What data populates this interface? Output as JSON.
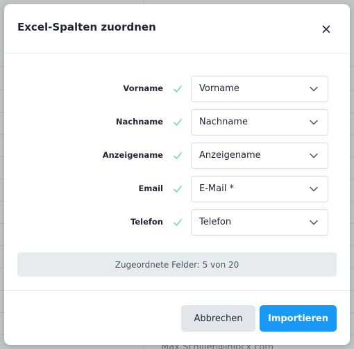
{
  "modal": {
    "title": "Excel-Spalten zuordnen",
    "mappings": [
      {
        "label": "Vorname",
        "selected": "Vorname"
      },
      {
        "label": "Nachname",
        "selected": "Nachname"
      },
      {
        "label": "Anzeigename",
        "selected": "Anzeigename"
      },
      {
        "label": "Email",
        "selected": "E-Mail *"
      },
      {
        "label": "Telefon",
        "selected": "Telefon"
      }
    ],
    "mapped_summary": "Zugeordnete Felder: 5 von 20",
    "cancel_label": "Abbrechen",
    "import_label": "Importieren"
  },
  "background": {
    "partial_email": "Max.Schiller@inlocx.com"
  },
  "colors": {
    "primary": "#1a98f5",
    "check": "#7fd1b0",
    "text": "#1f2433",
    "overlay": "#c2c4c6"
  },
  "icons": {
    "close": "close-icon",
    "check": "check-icon",
    "chevron": "chevron-down-icon"
  }
}
